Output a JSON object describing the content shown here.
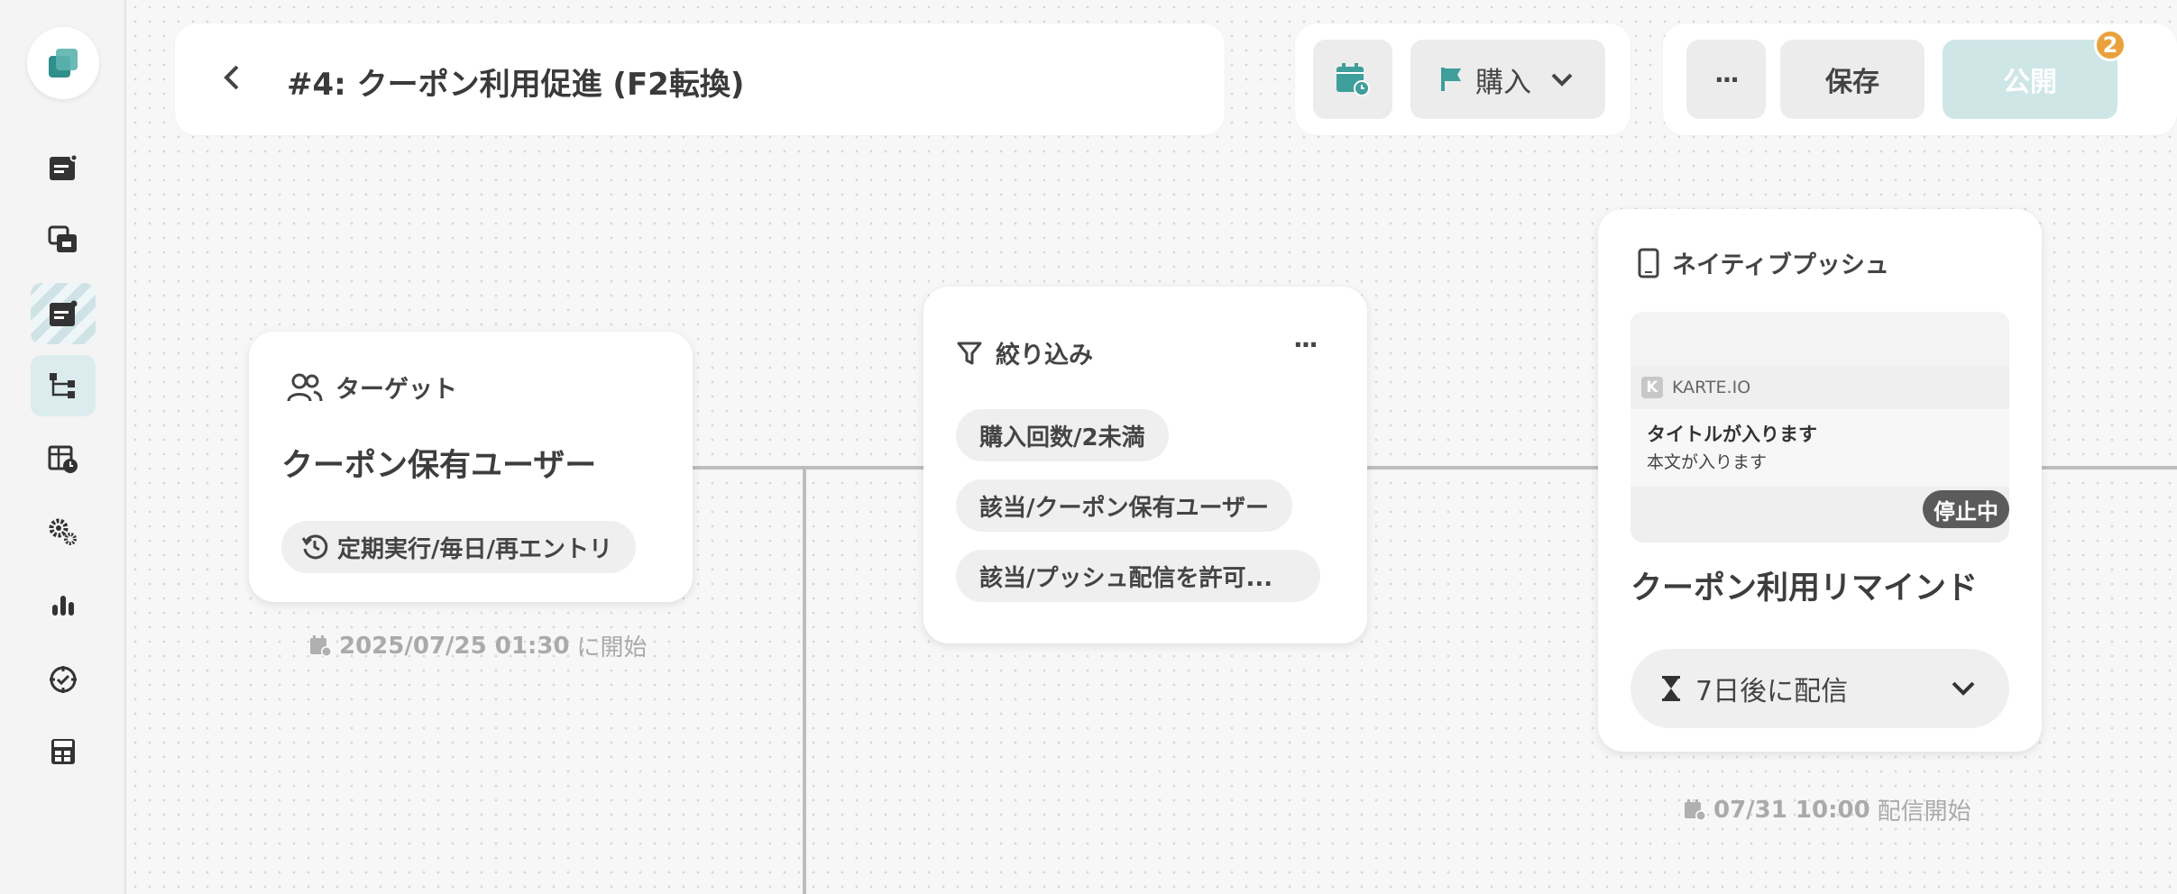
{
  "header": {
    "title": "#4: クーポン利用促進 (F2転換)",
    "goal_label": "購入",
    "more_label": "···",
    "save_label": "保存",
    "publish_label": "公開",
    "publish_badge": "2"
  },
  "sidebar": {
    "items": [
      {
        "icon": "campaign-icon"
      },
      {
        "icon": "layers-icon"
      },
      {
        "icon": "campaign-striped-icon"
      },
      {
        "icon": "flow-icon",
        "active": true
      },
      {
        "icon": "schedule-table-icon"
      },
      {
        "icon": "settings-icon"
      },
      {
        "icon": "chart-icon"
      },
      {
        "icon": "target-icon"
      },
      {
        "icon": "line-icon"
      }
    ]
  },
  "target_card": {
    "heading": "ターゲット",
    "name": "クーポン保有ユーザー",
    "schedule_chip": "定期実行/毎日/再エントリ",
    "start_date": "2025/07/25 01:30",
    "start_suffix": "に開始"
  },
  "filter_card": {
    "heading": "絞り込み",
    "more_label": "···",
    "conditions": [
      "購入回数/2未満",
      "該当/クーポン保有ユーザー",
      "該当/プッシュ配信を許可..."
    ]
  },
  "push_card": {
    "heading": "ネイティブプッシュ",
    "preview": {
      "app_name": "KARTE.IO",
      "notif_title": "タイトルが入ります",
      "notif_body": "本文が入ります",
      "status": "停止中"
    },
    "name": "クーポン利用リマインド",
    "delay_label": "7日後に配信",
    "delivery_date": "07/31 10:00",
    "delivery_suffix": "配信開始"
  },
  "colors": {
    "accent": "#3e9e9a",
    "publish_bg": "#cfe6e7",
    "badge": "#e9a23b",
    "status_bg": "#5b5b5b"
  }
}
